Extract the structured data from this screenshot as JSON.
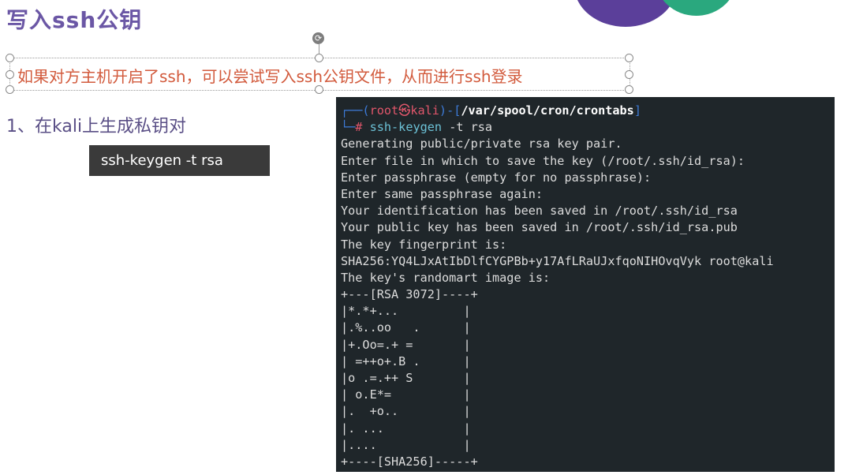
{
  "slide": {
    "title": "写入ssh公钥",
    "subtitle": "如果对方主机开启了ssh，可以尝试写入ssh公钥文件，从而进行ssh登录",
    "step": "1、在kali上生成私钥对",
    "command_box": "ssh-keygen -t rsa"
  },
  "terminal": {
    "prompt": {
      "user": "root",
      "at": "㉿",
      "host": "kali",
      "path": "/var/spool/cron/crontabs",
      "hash": "#",
      "command": "ssh-keygen",
      "args": "-t rsa"
    },
    "output": [
      "Generating public/private rsa key pair.",
      "Enter file in which to save the key (/root/.ssh/id_rsa):",
      "Enter passphrase (empty for no passphrase):",
      "Enter same passphrase again:",
      "Your identification has been saved in /root/.ssh/id_rsa",
      "Your public key has been saved in /root/.ssh/id_rsa.pub",
      "The key fingerprint is:",
      "SHA256:YQ4LJxAtIbDlfCYGPBb+y17AfLRaUJxfqoNIHOvqVyk root@kali",
      "The key's randomart image is:",
      "+---[RSA 3072]----+",
      "|*.*+...         |",
      "|.%..oo   .      |",
      "|+.Oo=.+ =       |",
      "| =++o+.B .      |",
      "|o .=.++ S       |",
      "| o.E*=          |",
      "|.  +o..         |",
      "|. ...           |",
      "|....            |",
      "+----[SHA256]-----+"
    ]
  },
  "colors": {
    "title": "#6b57a5",
    "subtitle": "#d25a3c",
    "terminal_bg": "#1f262a",
    "prompt_blue": "#3d7bd8",
    "prompt_red": "#e0566b",
    "command_cyan": "#6cc1d6"
  },
  "icons": {
    "rotate_handle": "rotate-icon"
  }
}
